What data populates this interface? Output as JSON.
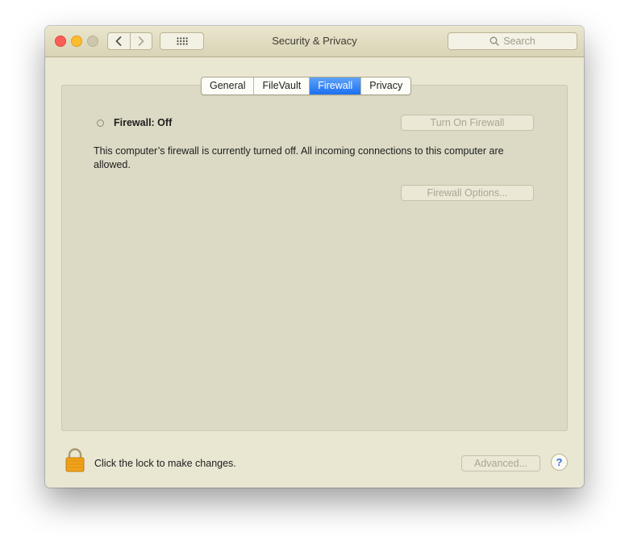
{
  "window": {
    "title": "Security & Privacy",
    "search_placeholder": "Search"
  },
  "toolbar": {
    "back_icon": "chevron-left-icon",
    "forward_icon": "chevron-right-icon",
    "grid_icon": "grid-icon"
  },
  "tabs": [
    {
      "label": "General",
      "active": false
    },
    {
      "label": "FileVault",
      "active": false
    },
    {
      "label": "Firewall",
      "active": true
    },
    {
      "label": "Privacy",
      "active": false
    }
  ],
  "firewall": {
    "status_label": "Firewall: Off",
    "turn_on_button": "Turn On Firewall",
    "description": "This computer’s firewall is currently turned off. All incoming connections to this computer are allowed.",
    "options_button": "Firewall Options..."
  },
  "footer": {
    "lock_text": "Click the lock to make changes.",
    "advanced_button": "Advanced...",
    "help_label": "?"
  },
  "colors": {
    "accent": "#1c6ff1",
    "window_bg": "#e9e6d2",
    "close": "#fc5f57",
    "minimize": "#fdbc2e",
    "lock": "#f0a21a"
  }
}
